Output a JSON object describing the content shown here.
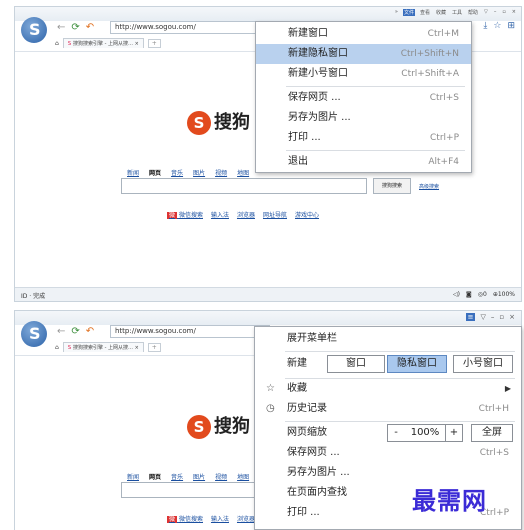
{
  "screen1": {
    "menubar": [
      "文件",
      "查看",
      "收藏",
      "工具",
      "帮助"
    ],
    "menubar_active": "文件",
    "address": "http://www.sogou.com/",
    "tab_label": "搜狗搜索引擎 - 上网从搜…",
    "search_logo_text": "搜狗",
    "search_nav": [
      "新闻",
      "网页",
      "音乐",
      "图片",
      "视频",
      "地图"
    ],
    "search_nav_current": "网页",
    "search_button": "搜狗搜索",
    "advanced_link": "高级搜索",
    "bottom_links": [
      "微信搜索",
      "输入法",
      "浏览器",
      "网址导航",
      "游戏中心"
    ],
    "status_left": "完成",
    "status_right": [
      "◎0",
      "⊕100%"
    ],
    "file_menu": [
      {
        "label": "新建窗口",
        "shortcut": "Ctrl+M"
      },
      {
        "label": "新建隐私窗口",
        "shortcut": "Ctrl+Shift+N",
        "highlighted": true
      },
      {
        "label": "新建小号窗口",
        "shortcut": "Ctrl+Shift+A"
      },
      {
        "label": "保存网页 ...",
        "shortcut": "Ctrl+S"
      },
      {
        "label": "另存为图片 ...",
        "shortcut": ""
      },
      {
        "label": "打印 ...",
        "shortcut": "Ctrl+P"
      },
      {
        "label": "退出",
        "shortcut": "Alt+F4"
      }
    ]
  },
  "screen2": {
    "address": "http://www.sogou.com/",
    "tab_label": "搜狗搜索引擎 - 上网从搜…",
    "search_logo_text": "搜狗",
    "search_nav": [
      "新闻",
      "网页",
      "音乐",
      "图片",
      "视频",
      "地图"
    ],
    "search_nav_current": "网页",
    "bottom_links": [
      "微信搜索",
      "输入法",
      "浏览器"
    ],
    "main_menu": {
      "expand_menubar": "展开菜单栏",
      "new_label": "新建",
      "new_buttons": [
        "窗口",
        "隐私窗口",
        "小号窗口"
      ],
      "new_active": "隐私窗口",
      "favorites": "收藏",
      "history": "历史记录",
      "history_shortcut": "Ctrl+H",
      "zoom_label": "网页缩放",
      "zoom_minus": "-",
      "zoom_value": "100%",
      "zoom_plus": "+",
      "fullscreen": "全屏",
      "save_page": "保存网页 ...",
      "save_shortcut": "Ctrl+S",
      "save_as_image": "另存为图片 ...",
      "find_in_page": "在页面内查找",
      "print": "打印 ...",
      "print_shortcut": "Ctrl+P"
    }
  },
  "watermark": "最需网",
  "colors": {
    "highlight": "#b9d1ee",
    "active_button": "#a9c8ee",
    "link": "#1a4fa0",
    "sogou_orange": "#e24a1d",
    "watermark": "#3b2bd6"
  }
}
